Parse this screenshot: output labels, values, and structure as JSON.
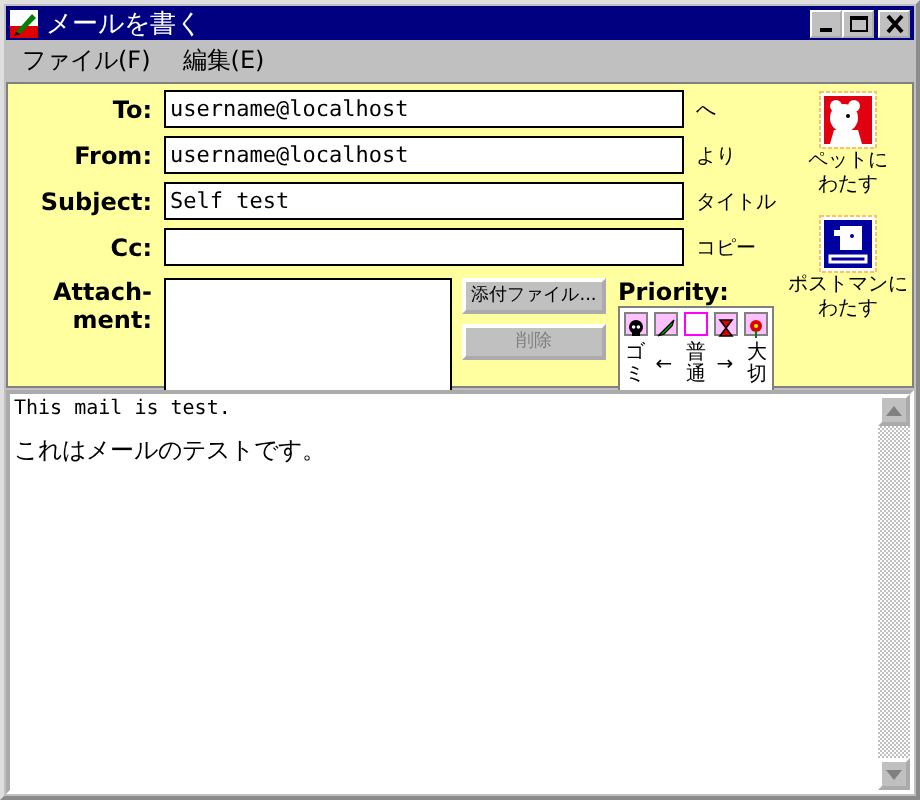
{
  "window": {
    "title": "メールを書く"
  },
  "menu": [
    {
      "label": "ファイル(F)"
    },
    {
      "label": "編集(E)"
    }
  ],
  "fields": [
    {
      "label": "To:",
      "value": "username@localhost",
      "suffix": "へ"
    },
    {
      "label": "From:",
      "value": "username@localhost",
      "suffix": "より"
    },
    {
      "label": "Subject:",
      "value": "Self test",
      "suffix": "タイトル"
    },
    {
      "label": "Cc:",
      "suffix": "コピー"
    }
  ],
  "attachment": {
    "label": "Attach-\nment:"
  },
  "buttons": [
    {
      "label": "添付ファイル...",
      "disabled": false
    },
    {
      "label": "削除",
      "disabled": true
    }
  ],
  "priority": {
    "title": "Priority:",
    "levels": [
      {
        "kind": "skull",
        "label": "ゴミ",
        "selected": false
      },
      {
        "kind": "leaf",
        "label": "←",
        "selected": false
      },
      {
        "kind": "blank",
        "label": "普通",
        "selected": true
      },
      {
        "kind": "hourglass",
        "label": "→",
        "selected": false
      },
      {
        "kind": "flower",
        "label": "大切",
        "selected": false
      }
    ]
  },
  "send_actions": [
    {
      "kind": "pet",
      "label": "ペットにわたす"
    },
    {
      "kind": "postman",
      "label": "ポストマンにわたす"
    }
  ],
  "body": {
    "lines": [
      "This mail is test.",
      "これはメールのテストです。"
    ]
  }
}
